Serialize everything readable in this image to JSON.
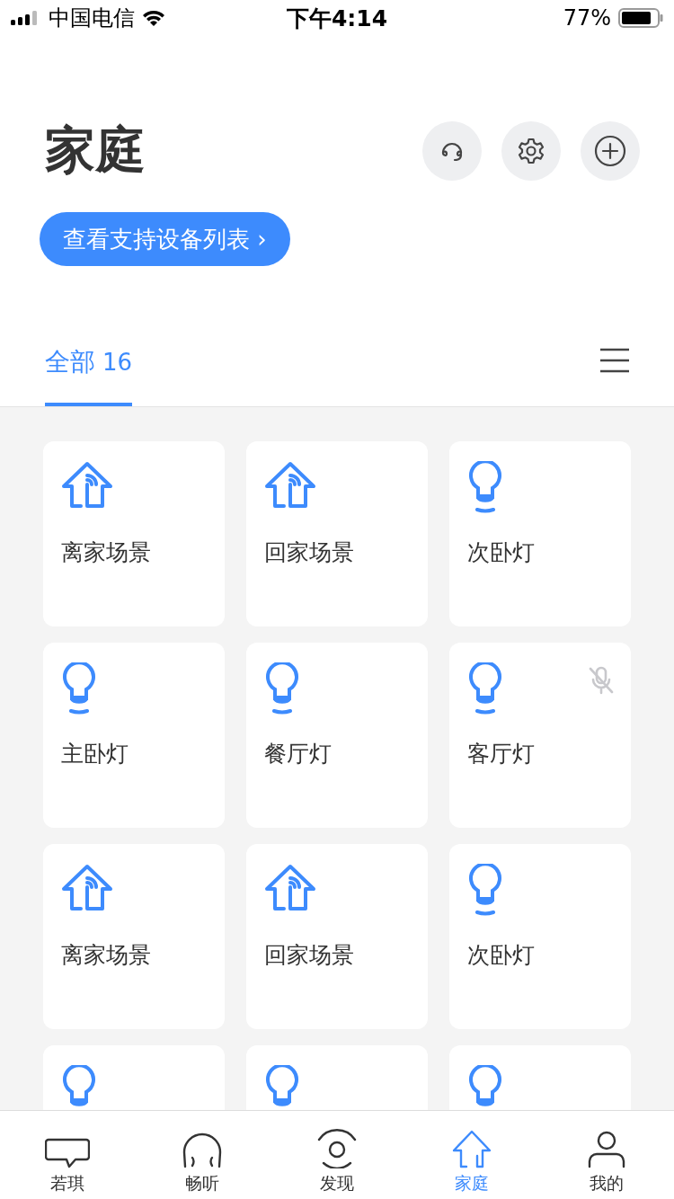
{
  "status_bar": {
    "carrier": "中国电信",
    "time": "下午4:14",
    "battery": "77%"
  },
  "header": {
    "title": "家庭",
    "support_link": "查看支持设备列表",
    "link_arrow": "›"
  },
  "tabs": [
    {
      "label": "全部",
      "count": "16",
      "selected": true
    }
  ],
  "devices": [
    {
      "kind": "scene",
      "name": "离家场景",
      "muted": false
    },
    {
      "kind": "scene",
      "name": "回家场景",
      "muted": false
    },
    {
      "kind": "light",
      "name": "次卧灯",
      "muted": false
    },
    {
      "kind": "light",
      "name": "主卧灯",
      "muted": false
    },
    {
      "kind": "light",
      "name": "餐厅灯",
      "muted": false
    },
    {
      "kind": "light",
      "name": "客厅灯",
      "muted": true
    },
    {
      "kind": "scene",
      "name": "离家场景",
      "muted": false
    },
    {
      "kind": "scene",
      "name": "回家场景",
      "muted": false
    },
    {
      "kind": "light",
      "name": "次卧灯",
      "muted": false
    },
    {
      "kind": "light",
      "muted": false
    },
    {
      "kind": "light",
      "muted": false
    },
    {
      "kind": "light",
      "muted": false
    }
  ],
  "tab_bar": [
    {
      "kind": "chat",
      "label": "若琪",
      "selected": false
    },
    {
      "kind": "listen",
      "label": "畅听",
      "selected": false
    },
    {
      "kind": "discover",
      "label": "发现",
      "selected": false
    },
    {
      "kind": "home",
      "label": "家庭",
      "selected": true
    },
    {
      "kind": "me",
      "label": "我的",
      "selected": false
    }
  ]
}
